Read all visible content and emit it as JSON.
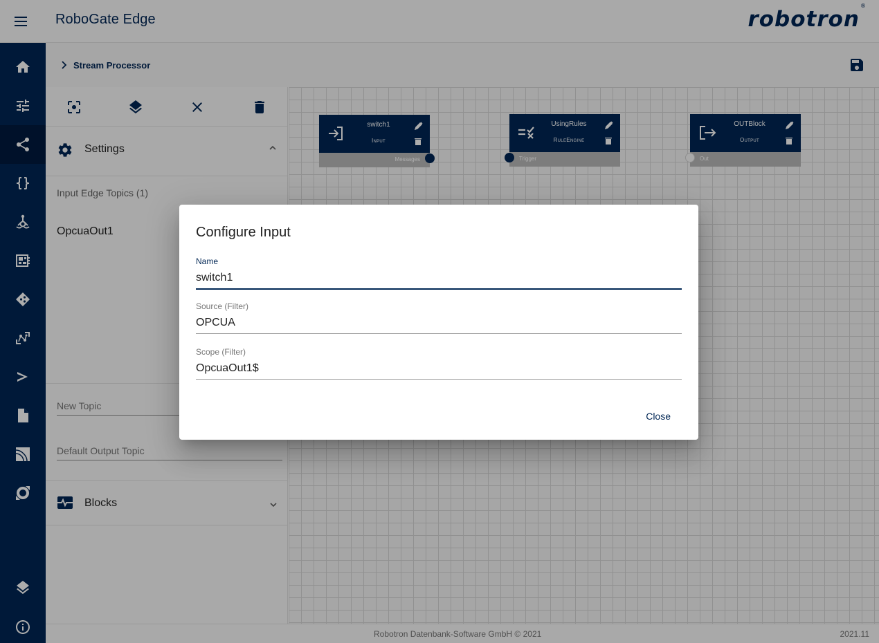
{
  "app": {
    "title": "RoboGate Edge",
    "brand": "robotron",
    "brand_mark": "®",
    "primary_color": "#002654"
  },
  "header": {
    "menu_icon": "menu-icon"
  },
  "sidenav": {
    "items": [
      {
        "icon": "home-icon",
        "label": "Home",
        "active": false
      },
      {
        "icon": "tune-icon",
        "label": "Settings",
        "active": false
      },
      {
        "icon": "share-icon",
        "label": "Stream Processor",
        "active": true
      },
      {
        "icon": "code-braces-icon",
        "label": "Scripts",
        "active": false
      },
      {
        "icon": "hub-icon",
        "label": "Hub",
        "active": false
      },
      {
        "icon": "dashboard-icon",
        "label": "Dashboard",
        "active": false
      },
      {
        "icon": "diamond-icon",
        "label": "Rules",
        "active": false
      },
      {
        "icon": "nodes-icon",
        "label": "Connections",
        "active": false
      },
      {
        "icon": "terminal-icon",
        "label": "Terminal",
        "active": false
      },
      {
        "icon": "file-icon",
        "label": "Files",
        "active": false
      },
      {
        "icon": "signal-icon",
        "label": "Signals",
        "active": false
      },
      {
        "icon": "ring-icon",
        "label": "Monitoring",
        "active": false
      }
    ],
    "bottom_items": [
      {
        "icon": "layers-icon",
        "label": "Layers"
      },
      {
        "icon": "info-icon",
        "label": "Info"
      }
    ]
  },
  "breadcrumb": {
    "items": [
      "Stream Processor"
    ]
  },
  "toolbar": {
    "buttons": [
      "center-focus",
      "layers",
      "clear",
      "delete"
    ]
  },
  "panel": {
    "settings_title": "Settings",
    "input_topics_label": "Input Edge Topics (1)",
    "input_topics": [
      "OpcuaOut1"
    ],
    "new_topic_placeholder": "New Topic",
    "default_output_placeholder": "Default Output Topic",
    "blocks_title": "Blocks"
  },
  "canvas": {
    "blocks": [
      {
        "name": "switch1",
        "type": "Input",
        "port_label": "Messages",
        "port_side": "right",
        "port_connected": true
      },
      {
        "name": "UsingRules",
        "type": "RuleEngine",
        "port_label": "Trigger",
        "port_side": "left",
        "port_connected": true
      },
      {
        "name": "OUTBlock",
        "type": "Output",
        "port_label": "Out",
        "port_side": "left",
        "port_connected": false
      }
    ]
  },
  "dialog": {
    "title": "Configure Input",
    "fields": [
      {
        "label": "Name",
        "value": "switch1",
        "focused": true
      },
      {
        "label": "Source (Filter)",
        "value": "OPCUA",
        "focused": false
      },
      {
        "label": "Scope (Filter)",
        "value": "OpcuaOut1$",
        "focused": false
      }
    ],
    "close_label": "Close"
  },
  "footer": {
    "copyright": "Robotron Datenbank-Software GmbH © 2021",
    "version": "2021.11"
  }
}
